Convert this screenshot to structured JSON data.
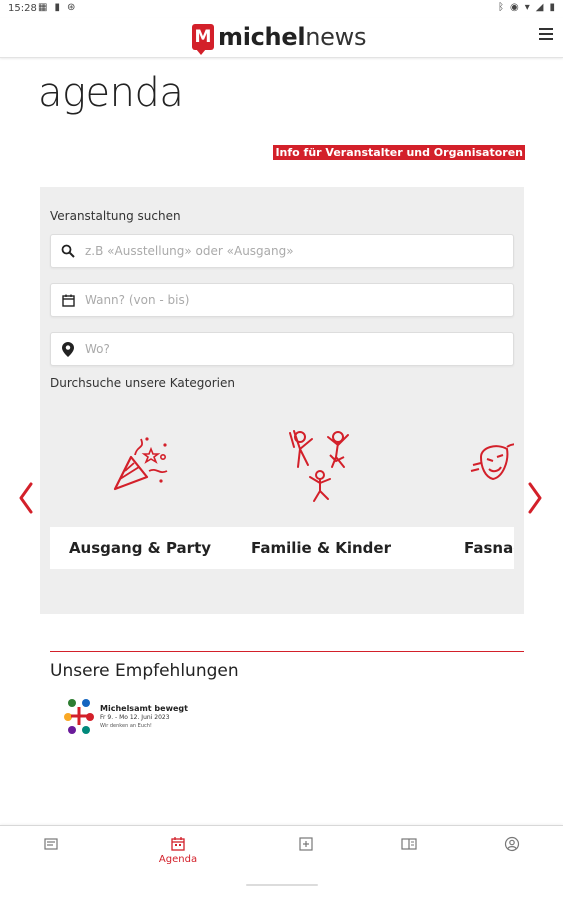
{
  "status_bar": {
    "time": "15:28",
    "left_icons": [
      "calendar-notification-icon",
      "battery-icon",
      "sync-icon"
    ],
    "right_icons": [
      "bluetooth-icon",
      "eye-comfort-icon",
      "wifi-icon",
      "signal-icon",
      "battery-icon"
    ]
  },
  "header": {
    "logo_mark": "M",
    "logo_bold": "michel",
    "logo_light": "news"
  },
  "page": {
    "title": "agenda",
    "info_link": "Info für Veranstalter und Organisatoren"
  },
  "search": {
    "label": "Veranstaltung suchen",
    "query_placeholder": "z.B «Ausstellung» oder «Ausgang»",
    "when_placeholder": "Wann? (von - bis)",
    "where_placeholder": "Wo?",
    "categories_label": "Durchsuche unsere Kategorien"
  },
  "categories": [
    {
      "name": "Ausgang & Party",
      "icon": "party-popper-icon"
    },
    {
      "name": "Familie & Kinder",
      "icon": "family-icon"
    },
    {
      "name": "Fasnacht",
      "icon": "carnival-mask-icon"
    }
  ],
  "recommendations": {
    "title": "Unsere Empfehlungen",
    "items": [
      {
        "name": "Michelsamt bewegt",
        "date": "Fr 9. - Mo 12. Juni 2023",
        "tagline": "Wir denken an Euch!"
      }
    ]
  },
  "bottom_nav": [
    {
      "icon": "news-icon",
      "label": ""
    },
    {
      "icon": "calendar-icon",
      "label": "Agenda",
      "active": true
    },
    {
      "icon": "plus-square-icon",
      "label": ""
    },
    {
      "icon": "epaper-icon",
      "label": ""
    },
    {
      "icon": "user-icon",
      "label": ""
    }
  ],
  "colors": {
    "brand_red": "#d3202a",
    "panel_bg": "#eeeeee"
  }
}
